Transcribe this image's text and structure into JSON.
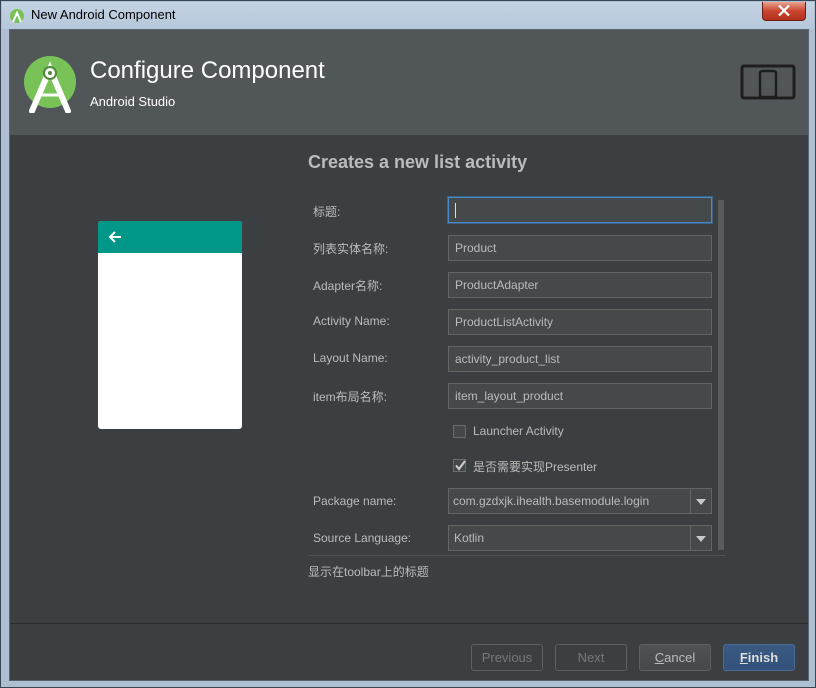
{
  "window": {
    "title": "New Android Component"
  },
  "header": {
    "title": "Configure Component",
    "subtitle": "Android Studio"
  },
  "section_title": "Creates a new list activity",
  "form": {
    "title_label": "标题:",
    "title_value": "",
    "entity_label": "列表实体名称:",
    "entity_value": "Product",
    "adapter_label": "Adapter名称:",
    "adapter_value": "ProductAdapter",
    "activity_label": "Activity Name:",
    "activity_value": "ProductListActivity",
    "layout_label": "Layout Name:",
    "layout_value": "activity_product_list",
    "item_layout_label": "item布局名称:",
    "item_layout_value": "item_layout_product",
    "launcher_label": "Launcher Activity",
    "launcher_checked": false,
    "presenter_label": "是否需要实现Presenter",
    "presenter_checked": true,
    "package_label": "Package name:",
    "package_value": "com.gzdxjk.ihealth.basemodule.login",
    "language_label": "Source Language:",
    "language_value": "Kotlin"
  },
  "hint": "显示在toolbar上的标题",
  "buttons": {
    "previous": "Previous",
    "next": "Next",
    "cancel_mnemonic": "C",
    "cancel_rest": "ancel",
    "finish_mnemonic": "F",
    "finish_rest": "inish"
  },
  "colors": {
    "dialog_bg": "#3c3f41",
    "header_bg": "#515658",
    "preview_toolbar": "#009688",
    "android_green": "#78c257",
    "focus_border": "#4a88c7",
    "primary_button": "#365880"
  }
}
